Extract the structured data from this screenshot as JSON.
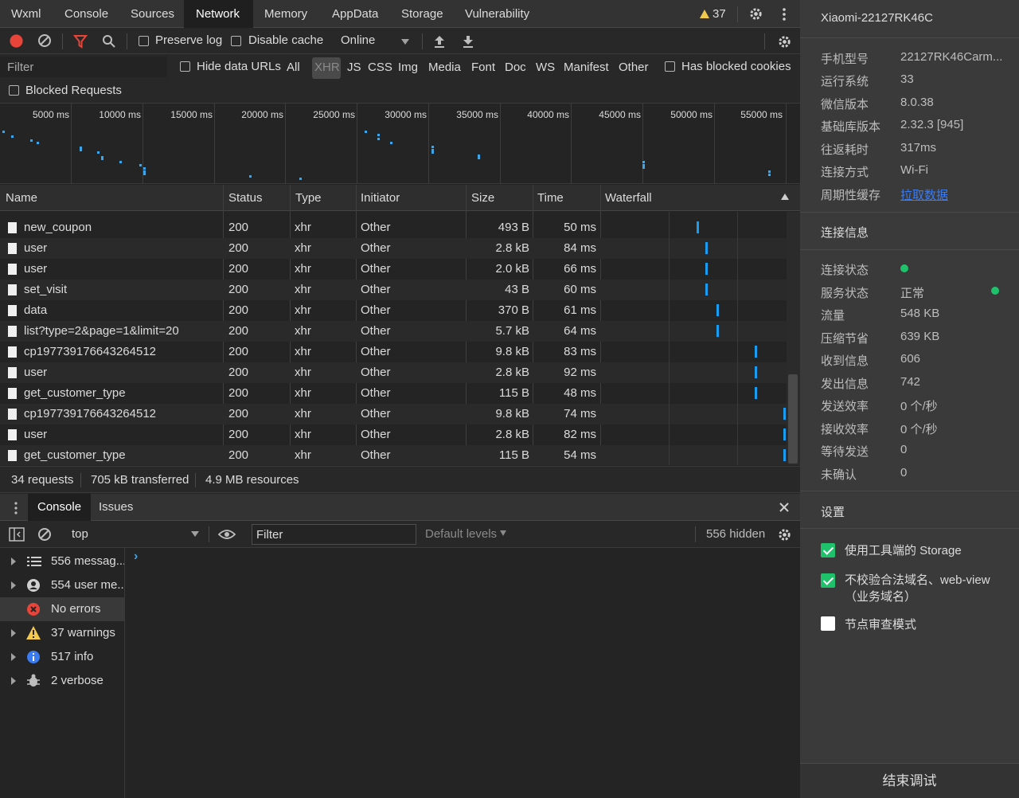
{
  "tabs": [
    "Wxml",
    "Console",
    "Sources",
    "Network",
    "Memory",
    "AppData",
    "Storage",
    "Vulnerability"
  ],
  "active_tab": "Network",
  "warning_count": "37",
  "toolbar": {
    "preserve_log": "Preserve log",
    "disable_cache": "Disable cache",
    "throttle": "Online"
  },
  "filterbar": {
    "filter_placeholder": "Filter",
    "hide_data_urls": "Hide data URLs",
    "types": [
      "All",
      "XHR",
      "JS",
      "CSS",
      "Img",
      "Media",
      "Font",
      "Doc",
      "WS",
      "Manifest",
      "Other"
    ],
    "selected_type": "XHR",
    "has_blocked_cookies": "Has blocked cookies",
    "blocked_requests": "Blocked Requests"
  },
  "overview_ticks": [
    "5000 ms",
    "10000 ms",
    "15000 ms",
    "20000 ms",
    "25000 ms",
    "30000 ms",
    "35000 ms",
    "40000 ms",
    "45000 ms",
    "50000 ms",
    "55000 ms"
  ],
  "table": {
    "headers": [
      "Name",
      "Status",
      "Type",
      "Initiator",
      "Size",
      "Time",
      "Waterfall"
    ],
    "rows": [
      {
        "name": "new_coupon",
        "status": "200",
        "type": "xhr",
        "initiator": "Other",
        "size": "493 B",
        "time": "50 ms"
      },
      {
        "name": "user",
        "status": "200",
        "type": "xhr",
        "initiator": "Other",
        "size": "2.8 kB",
        "time": "84 ms"
      },
      {
        "name": "user",
        "status": "200",
        "type": "xhr",
        "initiator": "Other",
        "size": "2.0 kB",
        "time": "66 ms"
      },
      {
        "name": "set_visit",
        "status": "200",
        "type": "xhr",
        "initiator": "Other",
        "size": "43 B",
        "time": "60 ms"
      },
      {
        "name": "data",
        "status": "200",
        "type": "xhr",
        "initiator": "Other",
        "size": "370 B",
        "time": "61 ms"
      },
      {
        "name": "list?type=2&page=1&limit=20",
        "status": "200",
        "type": "xhr",
        "initiator": "Other",
        "size": "5.7 kB",
        "time": "64 ms"
      },
      {
        "name": "cp197739176643264512",
        "status": "200",
        "type": "xhr",
        "initiator": "Other",
        "size": "9.8 kB",
        "time": "83 ms"
      },
      {
        "name": "user",
        "status": "200",
        "type": "xhr",
        "initiator": "Other",
        "size": "2.8 kB",
        "time": "92 ms"
      },
      {
        "name": "get_customer_type",
        "status": "200",
        "type": "xhr",
        "initiator": "Other",
        "size": "115 B",
        "time": "48 ms"
      },
      {
        "name": "cp197739176643264512",
        "status": "200",
        "type": "xhr",
        "initiator": "Other",
        "size": "9.8 kB",
        "time": "74 ms"
      },
      {
        "name": "user",
        "status": "200",
        "type": "xhr",
        "initiator": "Other",
        "size": "2.8 kB",
        "time": "82 ms"
      },
      {
        "name": "get_customer_type",
        "status": "200",
        "type": "xhr",
        "initiator": "Other",
        "size": "115 B",
        "time": "54 ms"
      }
    ]
  },
  "status": {
    "requests": "34 requests",
    "transferred": "705 kB transferred",
    "resources": "4.9 MB resources"
  },
  "drawer": {
    "tabs": [
      "Console",
      "Issues"
    ],
    "active": "Console",
    "context": "top",
    "filter_placeholder": "Filter",
    "levels": "Default levels",
    "hidden": "556 hidden",
    "prompt": "›",
    "sidebar": [
      {
        "label": "556 messag...",
        "icon": "list-icon"
      },
      {
        "label": "554 user me...",
        "icon": "user-icon"
      },
      {
        "label": "No errors",
        "icon": "error-icon"
      },
      {
        "label": "37 warnings",
        "icon": "warning-icon"
      },
      {
        "label": "517 info",
        "icon": "info-icon"
      },
      {
        "label": "2 verbose",
        "icon": "bug-icon"
      }
    ]
  },
  "device": {
    "title": "Xiaomi-22127RK46C",
    "info": [
      {
        "k": "手机型号",
        "v": "22127RK46Carm..."
      },
      {
        "k": "运行系统",
        "v": "33"
      },
      {
        "k": "微信版本",
        "v": "8.0.38"
      },
      {
        "k": "基础库版本",
        "v": "2.32.3 [945]"
      },
      {
        "k": "往返耗时",
        "v": "317ms"
      },
      {
        "k": "连接方式",
        "v": "Wi-Fi"
      },
      {
        "k": "周期性缓存",
        "v": "拉取数据"
      }
    ],
    "conn_head": "连接信息",
    "conn": [
      {
        "k": "连接状态",
        "v": ""
      },
      {
        "k": "服务状态",
        "v": "正常"
      },
      {
        "k": "流量",
        "v": "548 KB"
      },
      {
        "k": "压缩节省",
        "v": "639 KB"
      },
      {
        "k": "收到信息",
        "v": "606"
      },
      {
        "k": "发出信息",
        "v": "742"
      },
      {
        "k": "发送效率",
        "v": "0 个/秒"
      },
      {
        "k": "接收效率",
        "v": "0 个/秒"
      },
      {
        "k": "等待发送",
        "v": "0"
      },
      {
        "k": "未确认",
        "v": "0"
      }
    ],
    "settings_head": "设置",
    "settings": [
      {
        "label": "使用工具端的 Storage",
        "checked": true
      },
      {
        "label": "不校验合法域名、web-view（业务域名）",
        "checked": true
      },
      {
        "label": "节点审查模式",
        "checked": false
      }
    ],
    "end_button": "结束调试"
  },
  "colors": {
    "accent_blue": "#1a9cf0",
    "green": "#1ec26b",
    "record_red": "#e8443a"
  }
}
